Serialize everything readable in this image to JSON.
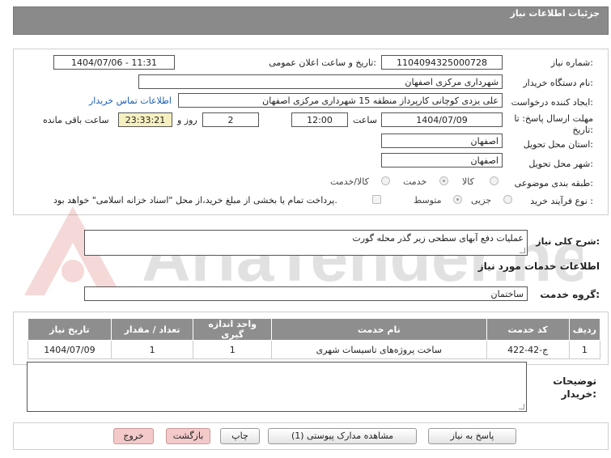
{
  "header": {
    "title": "جزئیات اطلاعات نیاز"
  },
  "form": {
    "need_number_label": "شماره نیاز:",
    "need_number": "1104094325000728",
    "announce_label": "تاریخ و ساعت اعلان عمومی:",
    "announce_value": "1404/07/06 - 11:31",
    "buyer_label": "نام دستگاه خریدار:",
    "buyer_value": "شهرداری مرکزی اصفهان",
    "creator_label": "ایجاد کننده درخواست:",
    "creator_value": "علی یزدی کوچانی کارپرداز منطقه 15 شهرداری مرکزی اصفهان",
    "contact_link": "اطلاعات تماس خریدار",
    "deadline_label_1": "مهلت ارسال پاسخ: تا",
    "deadline_label_2": "تاریخ:",
    "deadline_date": "1404/07/09",
    "time_label": "ساعت",
    "deadline_time": "12:00",
    "days_value": "2",
    "days_label": "روز و",
    "remaining_value": "23:33:21",
    "remaining_label": "ساعت باقی مانده",
    "province_label": "استان محل تحویل:",
    "province_value": "اصفهان",
    "city_label": "شهر محل تحویل:",
    "city_value": "اصفهان",
    "category_label": "طبقه بندی موضوعی:",
    "category_options": [
      "کالا",
      "خدمت",
      "کالا/خدمت"
    ],
    "category_selected": "خدمت",
    "process_label": "نوع فرآیند خرید :",
    "process_options": [
      "جزیی",
      "متوسط"
    ],
    "process_selected": "متوسط",
    "payment_note": "پرداخت تمام یا بخشی از مبلغ خرید،از محل \"اسناد خزانه اسلامی\" خواهد بود."
  },
  "summary": {
    "label": "شرح کلی نیاز:",
    "value": "عملیات دفع آبهای سطحی زیر گذر محله گورت"
  },
  "services": {
    "section_title": "اطلاعات خدمات مورد نیاز",
    "group_label": "گروه خدمت:",
    "group_value": "ساختمان",
    "columns": [
      "ردیف",
      "کد خدمت",
      "نام خدمت",
      "واحد اندازه گیری",
      "تعداد / مقدار",
      "تاریخ نیاز"
    ],
    "rows": [
      {
        "row": "1",
        "code": "ج-42-422",
        "name": "ساخت پروژه‌های تاسیسات شهری",
        "unit": "1",
        "qty": "1",
        "date": "1404/07/09"
      }
    ]
  },
  "buyer_notes": {
    "label_1": "توضیحات",
    "label_2": "خریدار:"
  },
  "buttons": {
    "reply": "پاسخ به نیاز",
    "attachments": "مشاهده مدارک پیوستی (1)",
    "print": "چاپ",
    "back": "بازگشت",
    "exit": "خروج"
  },
  "watermark": {
    "text": "AriaTender.net"
  },
  "colors": {
    "header_bg": "#8a8a8a",
    "link": "#1a5fb4",
    "remaining_bg": "#f6f0c0",
    "watermark": "#c81e1e"
  }
}
